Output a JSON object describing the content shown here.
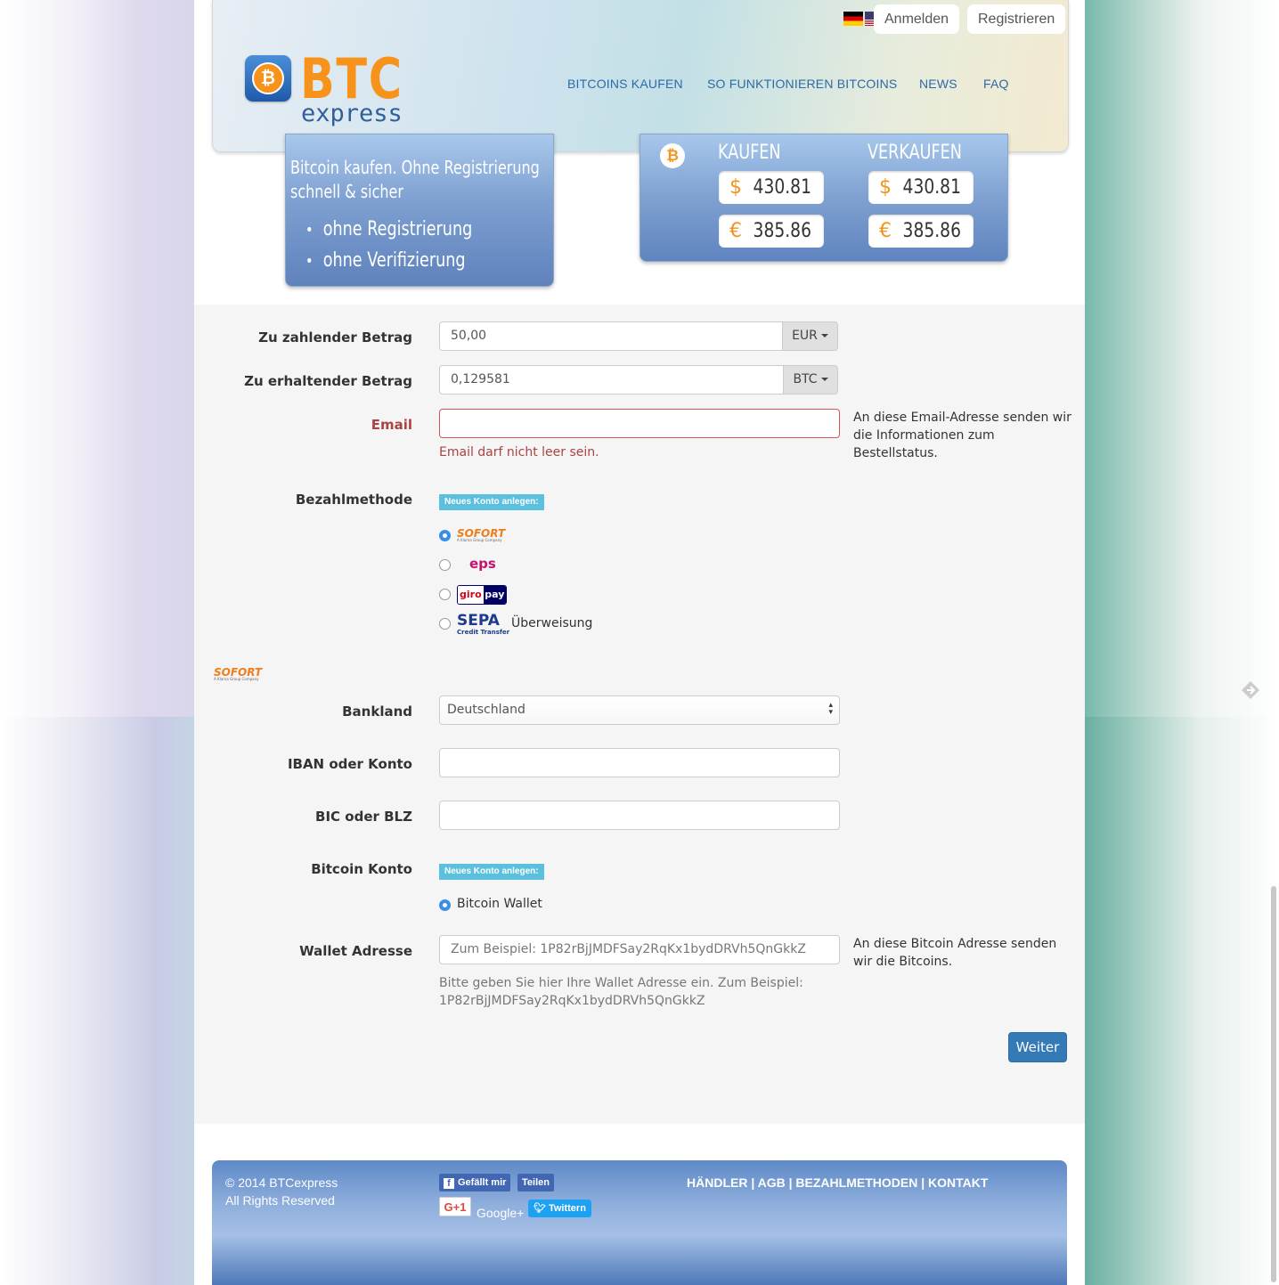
{
  "header": {
    "login": "Anmelden",
    "register": "Registrieren",
    "logo_btc": "BTC",
    "logo_express": "express",
    "logo_coin": "₿",
    "nav": [
      "BITCOINS KAUFEN",
      "SO FUNKTIONIEREN BITCOINS",
      "NEWS",
      "FAQ"
    ]
  },
  "promo": {
    "title_line1": "Bitcoin kaufen. Ohne Registrierung",
    "title_line2": "schnell & sicher",
    "bullets": [
      "ohne Registrierung",
      "ohne Verifizierung"
    ]
  },
  "ticker": {
    "coin": "₿",
    "buy_label": "KAUFEN",
    "sell_label": "VERKAUFEN",
    "usd_symbol": "$",
    "eur_symbol": "€",
    "buy_usd": "430.81",
    "buy_eur": "385.86",
    "sell_usd": "430.81",
    "sell_eur": "385.86"
  },
  "form": {
    "pay_amount_label": "Zu zahlender Betrag",
    "pay_amount_value": "50,00",
    "pay_currency": "EUR",
    "receive_amount_label": "Zu erhaltender Betrag",
    "receive_amount_value": "0,129581",
    "receive_currency": "BTC",
    "email_label": "Email",
    "email_value": "",
    "email_help": "An diese Email-Adresse senden wir die Informationen zum Bestellstatus.",
    "email_error": "Email darf nicht leer sein.",
    "payment_label": "Bezahlmethode",
    "new_account_badge": "Neues Konto anlegen:",
    "payment_options": {
      "sofort": "SOFORT",
      "sofort_sub": "A Klarna Group Company",
      "eps": "eps",
      "giro": "giro",
      "pay": "pay",
      "sepa": "SEPA",
      "sepa_sub": "Credit Transfer",
      "sepa_text": "Überweisung"
    },
    "sofort_logo": "SOFORT",
    "sofort_logo_sub": "A Klarna Group Company",
    "bank_country_label": "Bankland",
    "bank_country_value": "Deutschland",
    "iban_label": "IBAN oder Konto",
    "bic_label": "BIC oder BLZ",
    "bitcoin_account_label": "Bitcoin Konto",
    "bitcoin_account_badge": "Neues Konto anlegen:",
    "bitcoin_wallet_option": "Bitcoin Wallet",
    "wallet_label": "Wallet Adresse",
    "wallet_placeholder": "Zum Beispiel: 1P82rBjJMDFSay2RqKx1bydDRVh5QnGkkZ",
    "wallet_help_right": "An diese Bitcoin Adresse senden wir die Bitcoins.",
    "wallet_help_below_line1": "Bitte geben Sie hier Ihre Wallet Adresse ein. Zum Beispiel:",
    "wallet_help_below_line2": "1P82rBjJMDFSay2RqKx1bydDRVh5QnGkkZ",
    "submit": "Weiter"
  },
  "footer": {
    "copyright": "© 2014 BTCexpress",
    "rights": "All Rights Reserved",
    "fb_like": "Gefällt mir",
    "fb_share": "Teilen",
    "gplus": "G+1",
    "gplus_label": "Google+",
    "twitter": "Twittern",
    "links": "HÄNDLER | AGB | BEZAHLMETHODEN | KONTAKT"
  },
  "colors": {
    "accent": "#f7931a",
    "primary": "#337ab7",
    "error": "#a94442",
    "badge": "#5bc0de"
  }
}
